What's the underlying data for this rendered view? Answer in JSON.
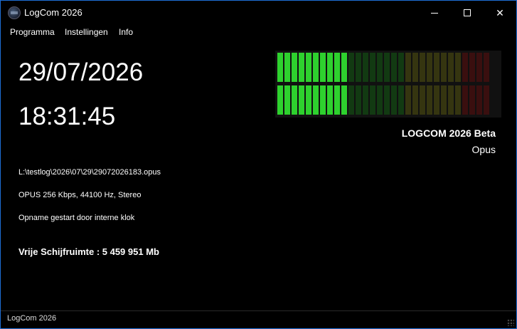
{
  "window": {
    "title": "LogCom 2026"
  },
  "menu": {
    "items": [
      "Programma",
      "Instellingen",
      "Info"
    ]
  },
  "clock": {
    "date": "29/07/2026",
    "time": "18:31:45"
  },
  "recording": {
    "file_path": "L:\\testlog\\2026\\07\\29\\29072026183.opus",
    "format": "OPUS 256 Kbps, 44100 Hz, Stereo",
    "status": "Opname gestart door interne klok",
    "disk_free": "Vrije Schijfruimte : 5 459 951 Mb"
  },
  "product": {
    "name": "LOGCOM 2026 Beta",
    "codec": "Opus"
  },
  "vu_meter": {
    "total_segments": 30,
    "left_active_segments": 10,
    "right_active_segments": 10,
    "colors": {
      "green_on": "#2ed12e",
      "green_off": "#123a12",
      "yellow_off": "#353510",
      "red_off": "#3a0f0f",
      "empty": "#161616"
    }
  },
  "statusbar": {
    "text": "LogCom 2026"
  }
}
